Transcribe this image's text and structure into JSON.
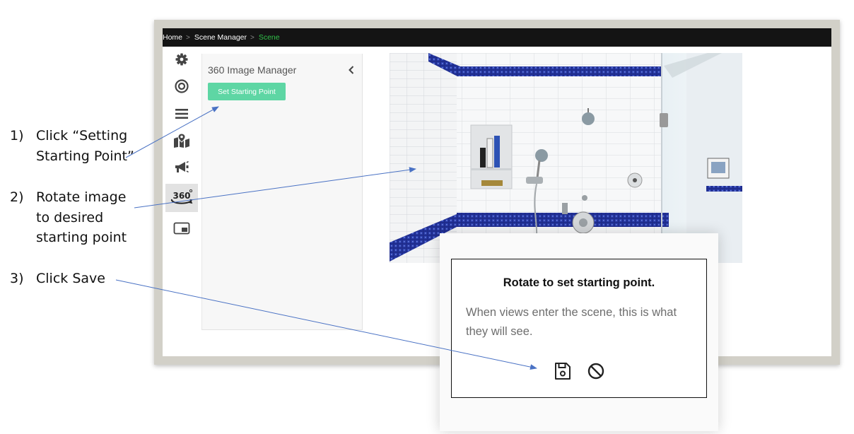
{
  "instructions": [
    {
      "number": "1)",
      "text": "Click “Setting Starting Point”"
    },
    {
      "number": "2)",
      "text": "Rotate image to desired starting point"
    },
    {
      "number": "3)",
      "text": "Click Save"
    }
  ],
  "breadcrumb": {
    "home": "Home",
    "scene_manager": "Scene Manager",
    "current": "Scene"
  },
  "sidebar": {
    "items": [
      {
        "icon": "gear-icon"
      },
      {
        "icon": "target-icon"
      },
      {
        "icon": "menu-icon"
      },
      {
        "icon": "map-pin-icon"
      },
      {
        "icon": "megaphone-icon"
      },
      {
        "icon": "360-view-icon",
        "active": true
      },
      {
        "icon": "picture-in-picture-icon"
      }
    ]
  },
  "panel": {
    "title": "360 Image Manager",
    "button_label": "Set Starting Point"
  },
  "dialog": {
    "title": "Rotate to set starting point.",
    "body": "When views enter the scene, this is what they will see.",
    "save_icon": "save-icon",
    "cancel_icon": "cancel-icon"
  },
  "colors": {
    "topbar": "#141414",
    "breadcrumb_active": "#31c24a",
    "button_green": "#5ed6a4",
    "tile_blue": "#1f2c8c",
    "arrow": "#4a72c4"
  }
}
